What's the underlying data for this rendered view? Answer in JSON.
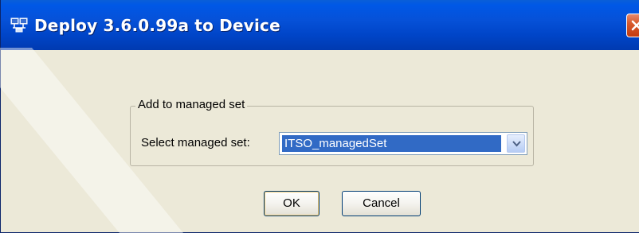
{
  "window": {
    "title": "Deploy 3.6.0.99a to Device",
    "title_icon": "network-device-icon",
    "close_icon": "close-icon"
  },
  "group": {
    "legend": "Add to managed set",
    "field_label": "Select managed set:",
    "selected_value": "ITSO_managedSet",
    "dropdown_icon": "chevron-down-icon"
  },
  "buttons": {
    "ok_label": "OK",
    "cancel_label": "Cancel"
  },
  "colors": {
    "titlebar": "#0054e3",
    "dialog_background": "#ece9d8",
    "selection": "#316ac5",
    "close_button": "#d85a2c"
  }
}
